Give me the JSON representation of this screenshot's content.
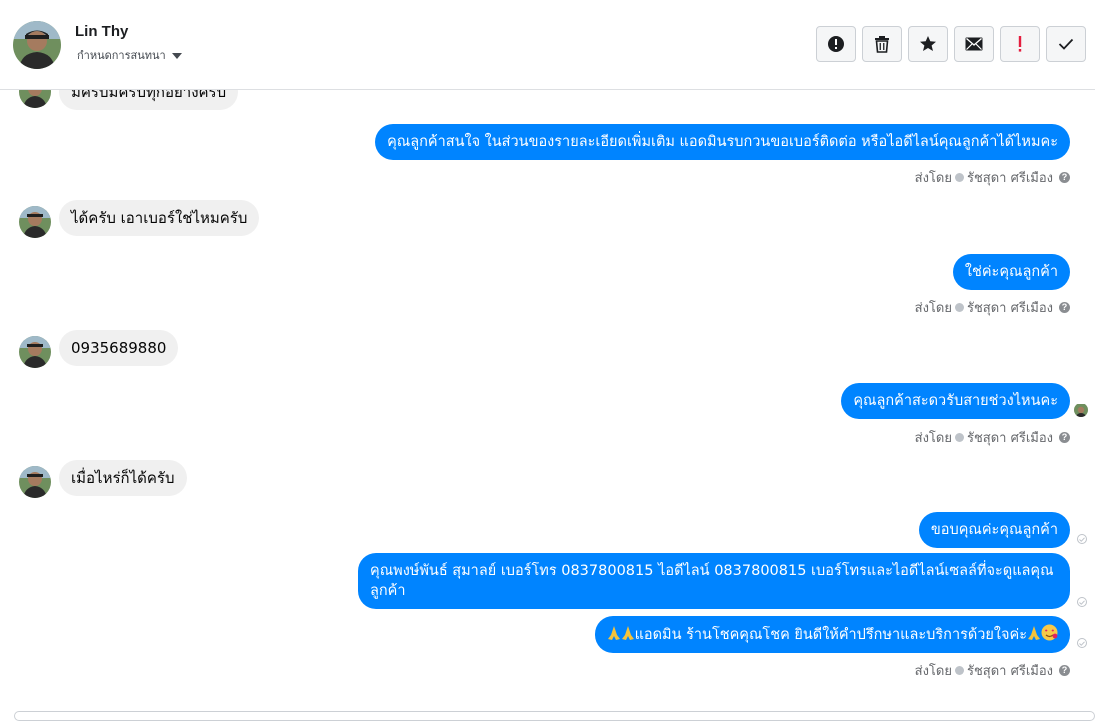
{
  "header": {
    "contact_name": "Lin Thy",
    "assign_label": "กำหนดการสนทนา",
    "toolbar": [
      {
        "icon": "alert-circle-icon",
        "name": "mark-spam-button"
      },
      {
        "icon": "trash-icon",
        "name": "delete-button"
      },
      {
        "icon": "star-icon",
        "name": "star-button"
      },
      {
        "icon": "envelope-icon",
        "name": "mark-unread-button"
      },
      {
        "icon": "exclamation-icon",
        "name": "follow-up-button"
      },
      {
        "icon": "checkmark-icon",
        "name": "mark-done-button"
      }
    ]
  },
  "messages": {
    "m1_in": "มีครับมีครับทุกอย่างครับ",
    "m2_out": "คุณลูกค้าสนใจ ในส่วนของรายละเอียดเพิ่มเติม แอดมินรบกวนขอเบอร์ติดต่อ หรือไอดีไลน์คุณลูกค้าได้ไหมคะ",
    "m3_in": "ได้ครับ เอาเบอร์ใช่ไหมครับ",
    "m4_out": "ใช่ค่ะคุณลูกค้า",
    "m5_in": "0935689880",
    "m6_out": "คุณลูกค้าสะดวรับสายช่วงไหนคะ",
    "m7_in": "เมื่อไหร่ก็ได้ครับ",
    "m8_out": "ขอบคุณค่ะคุณลูกค้า",
    "m9_out": "คุณพงษ์พันธ์ สุมาลย์      เบอร์โทร 0837800815  ไอดีไลน์ 0837800815    เบอร์โทรและไอดีไลน์เซลล์ที่จะดูแลคุณลูกค้า",
    "m10_out": "แอดมิน ร้านโชคคุณโชค ยินดีให้คำปรึกษาและบริการด้วยใจค่ะ"
  },
  "sent_by": {
    "prefix": "ส่งโดย",
    "agent": "รัชสุดา ศรีเมือง",
    "help": "?"
  },
  "colors": {
    "outgoing_bubble": "#0084ff",
    "incoming_bubble": "#f0f0f0",
    "meta_text": "#65676b"
  }
}
